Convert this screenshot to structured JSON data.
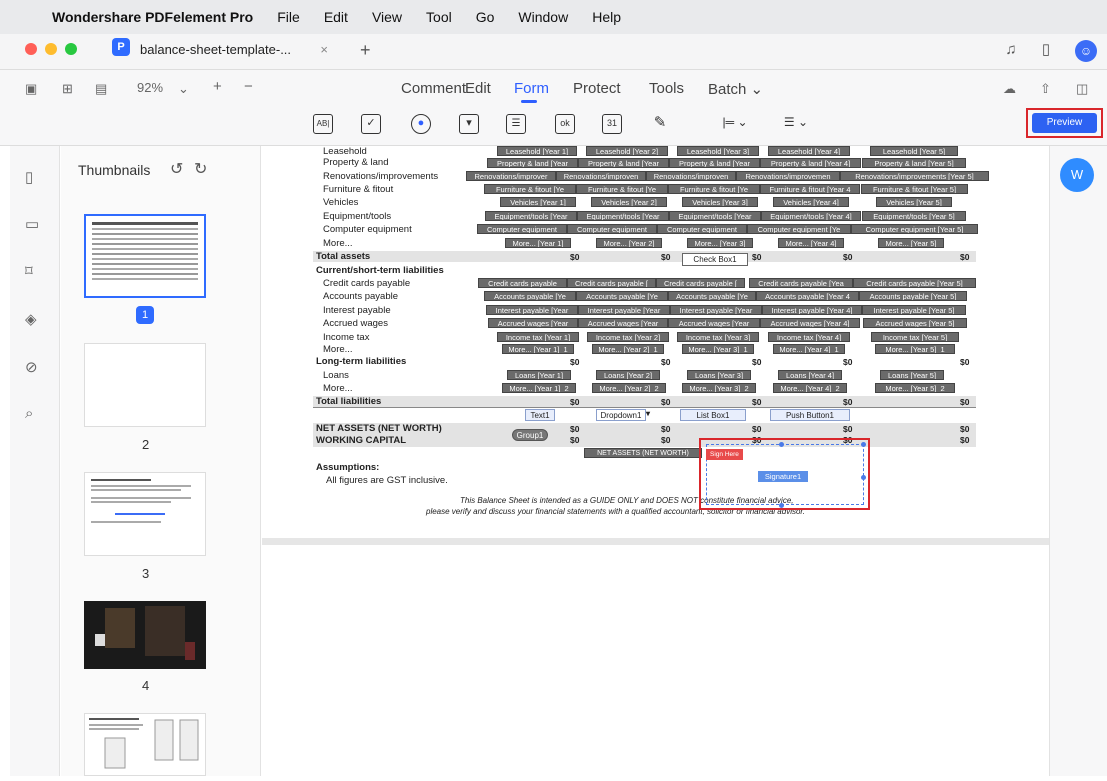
{
  "menubar": {
    "apple": "",
    "app_name": "Wondershare PDFelement Pro",
    "items": [
      "File",
      "Edit",
      "View",
      "Tool",
      "Go",
      "Window",
      "Help"
    ]
  },
  "tab": {
    "title": "balance-sheet-template-...",
    "close": "×",
    "new": "+"
  },
  "toolbar": {
    "zoom": "92%",
    "zoom_chevron": "⌄",
    "zoom_in": "+",
    "zoom_out": "−",
    "main_tabs": [
      "Comment",
      "Edit",
      "Form",
      "Protect",
      "Tools",
      "Batch ⌄"
    ],
    "active_tab": "Form",
    "form_icons": {
      "text_field": "AB|",
      "checkbox": "✓",
      "radio": "●",
      "dropdown": "▾",
      "listbox": "☰",
      "button": "ok",
      "date": "31",
      "signature": "✎",
      "align": "|═ ⌄",
      "distribute": "☰ ⌄"
    },
    "preview_label": "Preview"
  },
  "thumbnails": {
    "title": "Thumbnails",
    "rotate_left": "↺",
    "rotate_right": "↻",
    "pages": [
      "1",
      "2",
      "3",
      "4"
    ]
  },
  "ai_button": "W",
  "document": {
    "rows": [
      {
        "label": "Leasehold",
        "fields": [
          "Leasehold [Year 1]",
          "Leasehold [Year 2]",
          "Leasehold [Year 3]",
          "Leasehold [Year 4]",
          "Leasehold [Year 5]"
        ]
      },
      {
        "label": "Property & land",
        "fields": [
          "Property & land [Year",
          "Property & land [Year",
          "Property & land [Year",
          "Property & land [Year 4]",
          "Property & land [Year 5]"
        ]
      },
      {
        "label": "Renovations/improvements",
        "fields": [
          "Renovations/improver",
          "Renovations/improven",
          "Renovations/improven",
          "Renovations/improvemen",
          "Renovations/improvements [Year 5]"
        ]
      },
      {
        "label": "Furniture & fitout",
        "fields": [
          "Furniture & fitout [Ye",
          "Furniture & fitout [Ye",
          "Furniture & fitout [Ye",
          "Furniture & fitout [Year 4",
          "Furniture & fitout [Year 5]"
        ]
      },
      {
        "label": "Vehicles",
        "fields": [
          "Vehicles [Year 1]",
          "Vehicles [Year 2]",
          "Vehicles [Year 3]",
          "Vehicles [Year 4]",
          "Vehicles [Year 5]"
        ]
      },
      {
        "label": "Equipment/tools",
        "fields": [
          "Equipment/tools [Year",
          "Equipment/tools [Year",
          "Equipment/tools [Year",
          "Equipment/tools [Year 4]",
          "Equipment/tools [Year 5]"
        ]
      },
      {
        "label": "Computer equipment",
        "fields": [
          "Computer equipment",
          "Computer equipment",
          "Computer equipment",
          "Computer equipment [Ye",
          "Computer equipment [Year 5]"
        ]
      },
      {
        "label": "More...",
        "fields": [
          "More... [Year 1]",
          "More... [Year 2]",
          "More... [Year 3]",
          "More... [Year 4]",
          "More... [Year 5]"
        ]
      }
    ],
    "total_assets": {
      "label": "Total assets",
      "values": [
        "$0",
        "$0",
        "$0",
        "$0",
        "$0"
      ]
    },
    "check_box": "Check Box1",
    "current_header": "Current/short-term liabilities",
    "current_rows": [
      {
        "label": "Credit cards payable",
        "fields": [
          "Credit cards payable",
          "Credit cards payable [",
          "Credit cards payable [",
          "Credit cards payable [Yea",
          "Credit cards payable [Year 5]"
        ]
      },
      {
        "label": "Accounts payable",
        "fields": [
          "Accounts payable [Ye",
          "Accounts payable [Ye",
          "Accounts payable [Ye",
          "Accounts payable [Year 4",
          "Accounts payable [Year 5]"
        ]
      },
      {
        "label": "Interest payable",
        "fields": [
          "Interest payable [Year",
          "Interest payable [Year",
          "Interest payable [Year",
          "Interest payable [Year 4]",
          "Interest payable [Year 5]"
        ]
      },
      {
        "label": "Accrued wages",
        "fields": [
          "Accrued wages [Year",
          "Accrued wages [Year",
          "Accrued wages [Year",
          "Accrued wages [Year 4]",
          "Accrued wages [Year 5]"
        ]
      },
      {
        "label": "Income tax",
        "fields": [
          "Income tax [Year 1]",
          "Income tax [Year 2]",
          "Income tax [Year 3]",
          "Income tax [Year 4]",
          "Income tax [Year 5]"
        ]
      },
      {
        "label": "More...",
        "fields": [
          "More... [Year 1]_1",
          "More... [Year 2]_1",
          "More... [Year 3]_1",
          "More... [Year 4]_1",
          "More... [Year 5]_1"
        ]
      }
    ],
    "current_total": [
      "$0",
      "$0",
      "$0",
      "$0",
      "$0"
    ],
    "long_header": "Long-term liabilities",
    "long_rows": [
      {
        "label": "Loans",
        "fields": [
          "Loans [Year 1]",
          "Loans [Year 2]",
          "Loans [Year 3]",
          "Loans [Year 4]",
          "Loans [Year 5]"
        ]
      },
      {
        "label": "More...",
        "fields": [
          "More... [Year 1]_2",
          "More... [Year 2]_2",
          "More... [Year 3]_2",
          "More... [Year 4]_2",
          "More... [Year 5]_2"
        ]
      }
    ],
    "long_total": [
      "$0",
      "$0",
      "$0",
      "$0",
      "$0"
    ],
    "total_liabilities": {
      "label": "Total liabilities",
      "values": [
        "$0",
        "$0",
        "$0",
        "$0",
        "$0"
      ]
    },
    "widgets": {
      "text": "Text1",
      "dropdown": "Dropdown1",
      "listbox": "List Box1",
      "pushbutton": "Push Button1",
      "group": "Group1",
      "net_assets_field": "NET ASSETS (NET WORTH)"
    },
    "net_assets": {
      "label": "NET ASSETS (NET WORTH)",
      "values": [
        "$0",
        "$0",
        "$0",
        "$0",
        "$0"
      ]
    },
    "working_capital": {
      "label": "WORKING CAPITAL",
      "values": [
        "$0",
        "$0",
        "$0",
        "$0",
        "$0"
      ]
    },
    "assumptions_title": "Assumptions:",
    "assumptions_text": "All figures are GST inclusive.",
    "disclaimer1": "This Balance Sheet is intended as a GUIDE ONLY and DOES NOT constitute financial advice,",
    "disclaimer2": "please verify and discuss your financial statements with a qualified accountant, solicitor or financial advisor.",
    "sign_here": "Sign Here",
    "signature": "Signature1"
  }
}
